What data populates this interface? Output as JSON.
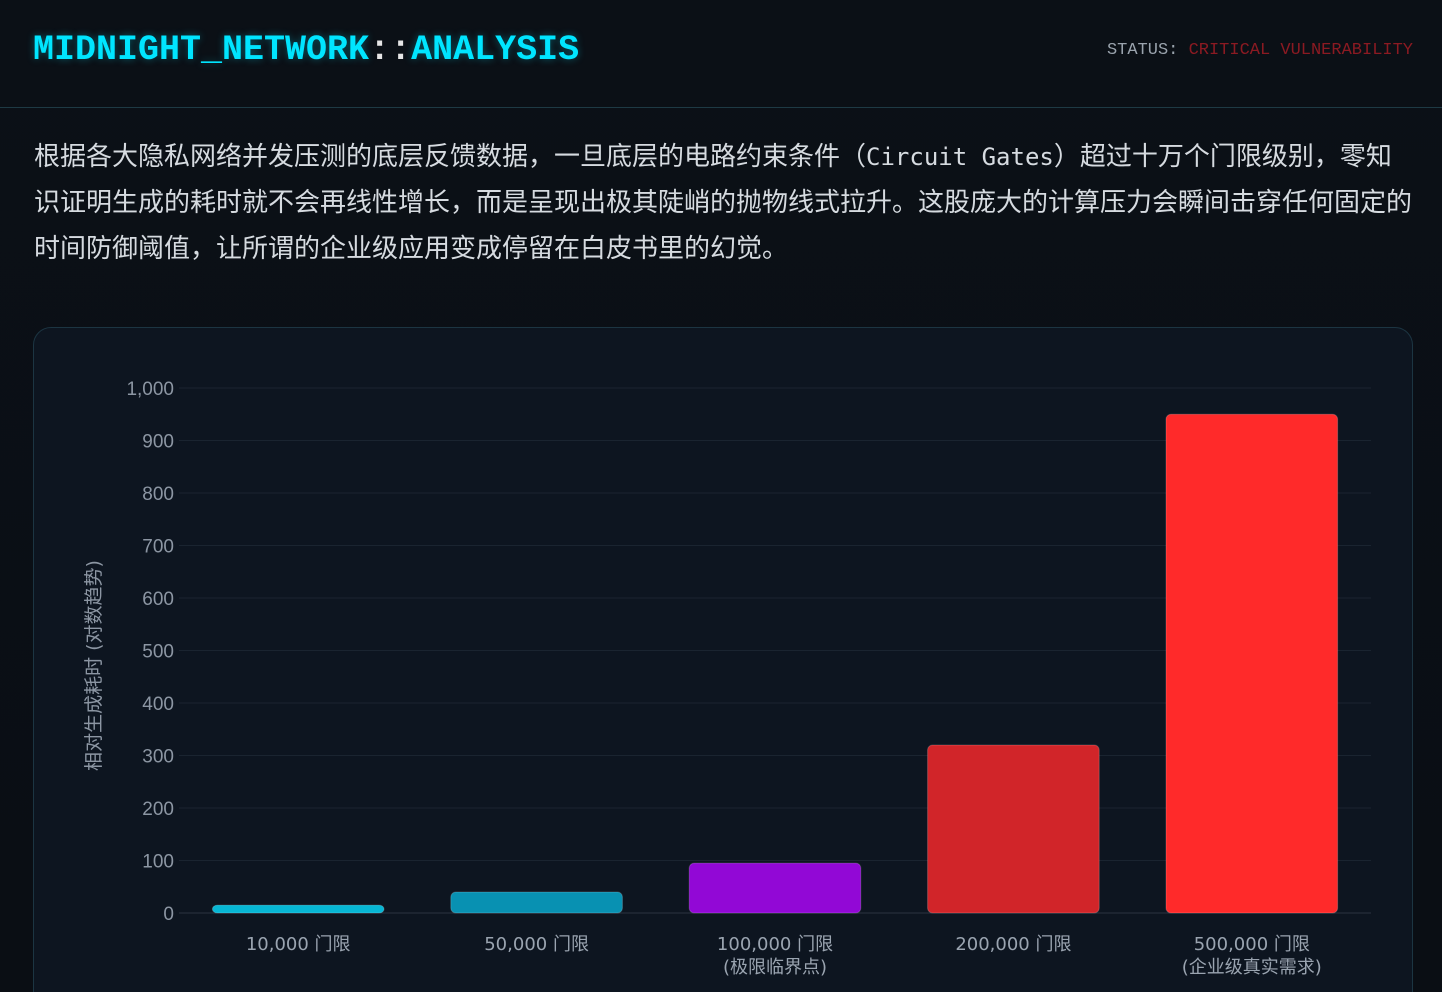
{
  "header": {
    "brand_main": "MIDNIGHT_NETWORK",
    "brand_sep": "::",
    "brand_sub": "ANALYSIS",
    "status_label": "STATUS:",
    "status_value": "CRITICAL VULNERABILITY"
  },
  "intro": {
    "text_before": "根据各大隐私网络并发压测的底层反馈数据，一旦底层的电路约束条件（",
    "text_mono": "Circuit Gates",
    "text_after": "）超过十万个门限级别，零知识证明生成的耗时就不会再线性增长，而是呈现出极其陡峭的抛物线式拉升。这股庞大的计算压力会瞬间击穿任何固定的时间防御阈值，让所谓的企业级应用变成停留在白皮书里的幻觉。"
  },
  "colors": {
    "accent": "#00e5ff",
    "critical": "#8b1a22",
    "bars": [
      "#06b6d4",
      "#0891b2",
      "#9208d6",
      "#d12529",
      "#ff2a2a"
    ]
  },
  "chart_data": {
    "type": "bar",
    "categories": [
      [
        "10,000 门限"
      ],
      [
        "50,000 门限"
      ],
      [
        "100,000 门限",
        "(极限临界点)"
      ],
      [
        "200,000 门限"
      ],
      [
        "500,000 门限",
        "(企业级真实需求)"
      ]
    ],
    "values": [
      15,
      40,
      95,
      320,
      950
    ],
    "ylabel": "相对生成耗时 (对数趋势)",
    "xlabel": "",
    "ylim": [
      0,
      1000
    ],
    "yticks": [
      "0",
      "100",
      "200",
      "300",
      "400",
      "500",
      "600",
      "700",
      "800",
      "900",
      "1,000"
    ],
    "grid": true,
    "legend": "none"
  }
}
